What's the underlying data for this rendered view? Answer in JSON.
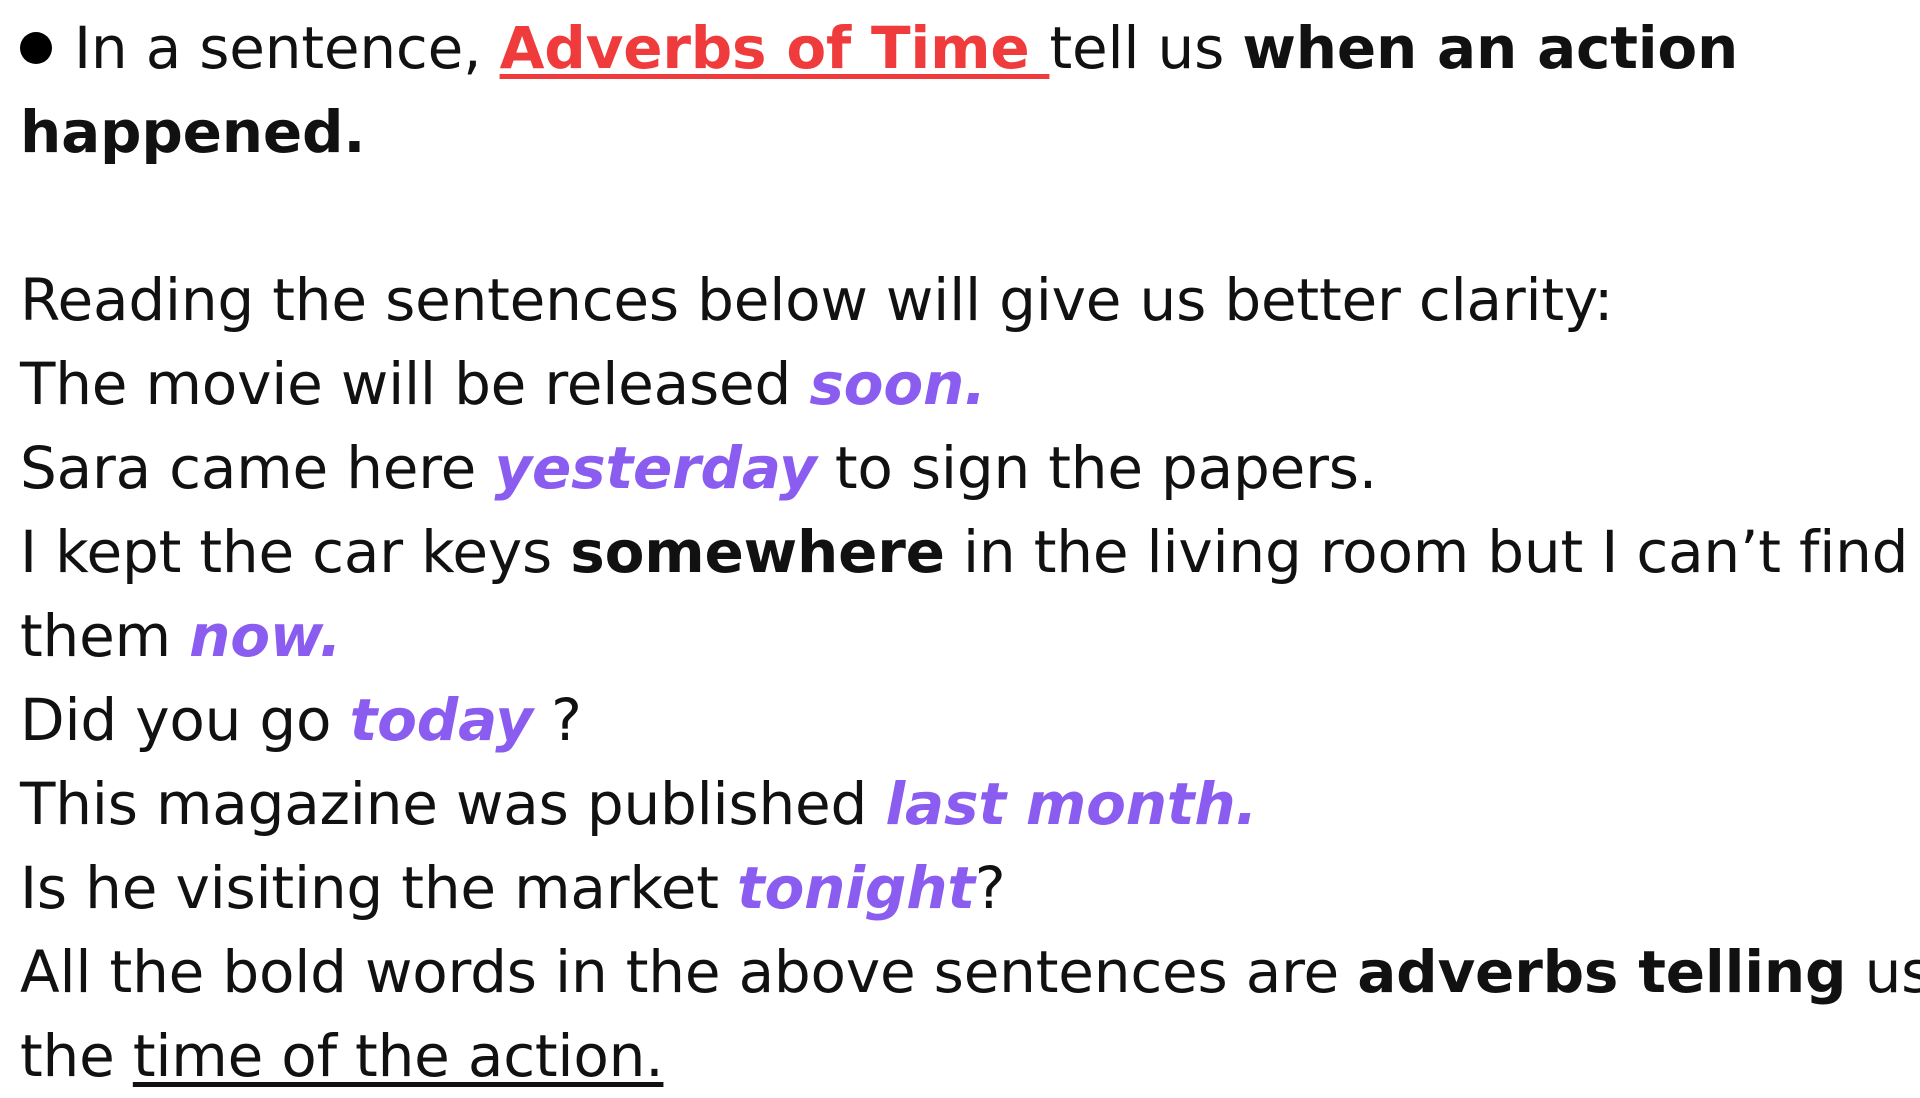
{
  "intro": {
    "prefix": "In a sentence, ",
    "term": "Adverbs of Time ",
    "middle": "tell us ",
    "bold_end": "when an action",
    "bold_line2": "happened."
  },
  "lead": "Reading the sentences below will give us better clarity:",
  "sentences": [
    {
      "before": "The movie will be released ",
      "adverb": "soon.",
      "after": ""
    },
    {
      "before": "Sara came here ",
      "adverb": "yesterday",
      "after": " to sign the papers."
    },
    {
      "before": "I kept the car keys ",
      "bold": "somewhere",
      "middle": " in the living room but I can’t find",
      "line2_before": "them ",
      "adverb": "now.",
      "after": ""
    },
    {
      "before": "Did you go ",
      "adverb": "today",
      "after": " ?"
    },
    {
      "before": "This magazine was published ",
      "adverb": "last month.",
      "after": ""
    },
    {
      "before": "Is he visiting the market ",
      "adverb": "tonight",
      "after": "?"
    }
  ],
  "conclusion": {
    "before": "All the bold words in the above sentences are ",
    "bold": "adverbs telling",
    "after": " us",
    "line2_before": "the ",
    "underlined": "time of the action."
  },
  "colors": {
    "term": "#ef3b3b",
    "adverb": "#8b5cf0",
    "text": "#111111"
  }
}
